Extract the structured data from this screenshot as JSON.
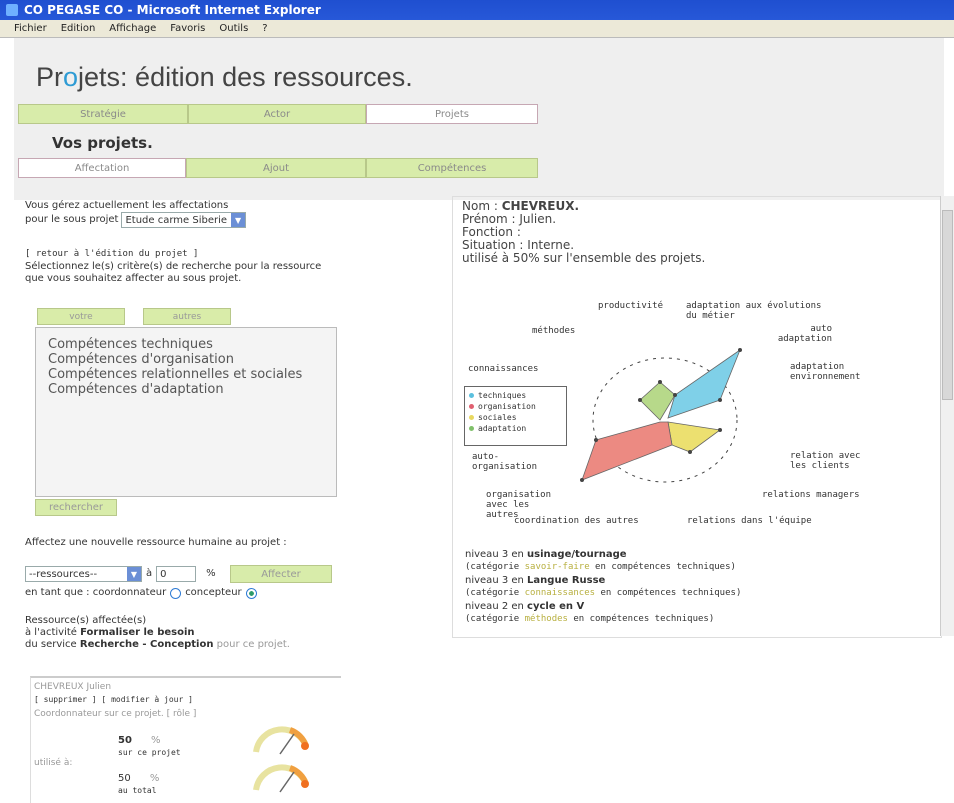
{
  "window": {
    "title": "CO PEGASE CO - Microsoft Internet Explorer"
  },
  "menu": [
    "Fichier",
    "Edition",
    "Affichage",
    "Favoris",
    "Outils",
    "?"
  ],
  "page_title": {
    "pre": "Pr",
    "o": "o",
    "post": "jets: édition des ressources."
  },
  "main_tabs": [
    "Stratégie",
    "Actor",
    "Projets"
  ],
  "section_title": "Vos projets.",
  "sub_tabs": [
    "Affectation",
    "Ajout",
    "Compétences"
  ],
  "left": {
    "line1": "Vous gérez actuellement les affectations",
    "line2": "pour le sous projet",
    "subproject": "Etude carme Siberie",
    "back_link": "[ retour à l'édition du projet ]",
    "instr1": "Sélectionnez le(s) critère(s) de recherche pour la ressource",
    "instr2": "que vous souhaitez affecter au sous projet.",
    "crit_tabs": [
      "votre",
      "autres"
    ],
    "criteria": [
      "Compétences techniques",
      "Compétences d'organisation",
      "Compétences relationnelles et sociales",
      "Compétences d'adaptation"
    ],
    "search_btn": "rechercher",
    "assign_label": "Affectez une nouvelle ressource humaine au projet :",
    "resource_select": "--ressources--",
    "pct_prefix": "à",
    "pct_value": "0",
    "pct_unit": "%",
    "assign_btn": "Affecter",
    "role_label": "en tant que : coordonnateur",
    "role_alt": "concepteur",
    "assigned1": "Ressource(s) affectée(s)",
    "assigned2a": "à l'activité ",
    "assigned2b": "Formaliser le besoin",
    "assigned3a": "du service ",
    "assigned3b": "Recherche - Conception",
    "assigned3c": " pour ce projet.",
    "card": {
      "name": "CHEVREUX Julien",
      "links": "[ supprimer ] [ modifier à jour ]",
      "coord": "Coordonnateur sur ce projet. [ rôle ]",
      "used_label": "utilisé à:",
      "val1": "50",
      "unit1": "%",
      "sub1": "sur ce projet",
      "val2": "50",
      "unit2": "%",
      "sub2": "au total"
    }
  },
  "right": {
    "name_label": "Nom : ",
    "name": "CHEVREUX.",
    "prenom": "Prénom : Julien.",
    "fonction": "Fonction :",
    "situation": "Situation : Interne.",
    "usage": "utilisé à 50% sur l'ensemble des projets.",
    "radar_labels": [
      "productivité",
      "adaptation aux évolutions du métier",
      "auto adaptation",
      "adaptation environnement",
      "relation avec les clients",
      "relations managers",
      "relations dans l'équipe",
      "coordination des autres",
      "organisation avec les autres",
      "auto-organisation",
      "connaissances",
      "méthodes"
    ],
    "legend": [
      {
        "label": "techniques",
        "color": "#5bc0de"
      },
      {
        "label": "organisation",
        "color": "#e06070"
      },
      {
        "label": "sociales",
        "color": "#e8d860"
      },
      {
        "label": "adaptation",
        "color": "#7fc06a"
      }
    ],
    "levels": [
      {
        "a": "niveau 3 en ",
        "b": "usinage/tournage",
        "c": "(catégorie ",
        "d": "savoir-faire",
        "e": " en compétences techniques)"
      },
      {
        "a": "niveau 3 en ",
        "b": "Langue Russe",
        "c": "(catégorie ",
        "d": "connaissances",
        "e": " en compétences techniques)"
      },
      {
        "a": "niveau 2 en ",
        "b": "cycle en V",
        "c": "(catégorie ",
        "d": "méthodes",
        "e": " en compétences techniques)"
      }
    ]
  },
  "colors": {
    "tab_green": "#d8ecaa",
    "accent_blue": "#2e9bd4",
    "titlebar": "#2758d8"
  }
}
